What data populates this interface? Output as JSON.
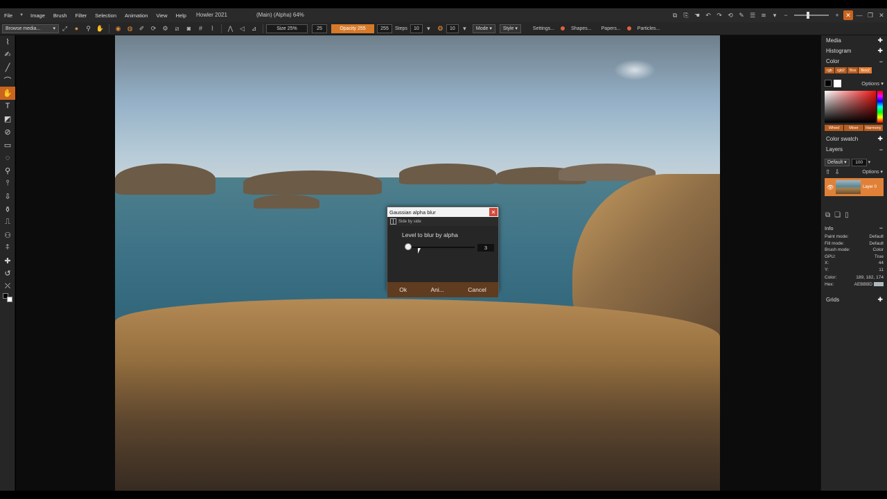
{
  "menu": {
    "items": [
      "File",
      "Image",
      "Brush",
      "Filter",
      "Selection",
      "Animation",
      "View",
      "Help"
    ],
    "app_title": "Howler 2021",
    "doc_title": "(Main) (Alpha)  64%"
  },
  "toolbar": {
    "browse_label": "Browse media...",
    "size_label": "Size 25%",
    "size_value": "25",
    "opacity_label": "Opacity 255",
    "opacity_value": "255",
    "steps_label": "Steps",
    "steps_value": "10",
    "spacing_value": "10",
    "mode_label": "Mode",
    "style_label": "Style",
    "settings_label": "Settings...",
    "shapes_label": "Shapes...",
    "papers_label": "Papers...",
    "particles_label": "Particles..."
  },
  "dialog": {
    "title": "Gaussian alpha blur",
    "side_by_side": "Side by side",
    "level_label": "Level to blur by alpha",
    "level_value": "3",
    "level_fraction": 0.0,
    "ok_label": "Ok",
    "ani_label": "Ani...",
    "cancel_label": "Cancel"
  },
  "right_panel": {
    "media": "Media",
    "histogram": "Histogram",
    "color": "Color",
    "color_tabs": [
      "rgb",
      "rgb2",
      "Box",
      "Box2"
    ],
    "options_label": "Options",
    "picker_tabs": [
      "Wheel",
      "Mixer",
      "Harmony"
    ],
    "color_swatch": "Color swatch",
    "layers": "Layers",
    "layer_mode": "Default",
    "layer_opacity": "100",
    "layer_options": "Options",
    "layer_name": "Layer 0",
    "info": "Info",
    "info_rows": [
      {
        "k": "Paint mode:",
        "v": "Default"
      },
      {
        "k": "Fill mode:",
        "v": "Default"
      },
      {
        "k": "Brush mode:",
        "v": "Color"
      },
      {
        "k": "GPU:",
        "v": "True"
      },
      {
        "k": "X:",
        "v": "44"
      },
      {
        "k": "Y:",
        "v": "11"
      }
    ],
    "color_readout_label": "Color:",
    "color_readout": "189, 182, 174",
    "hex_label": "Hex:",
    "hex_value": "AEBBBD",
    "grids": "Grids"
  },
  "colors": {
    "accent": "#c8641e",
    "dialog_footer": "#5f3b1f",
    "hex_swatch": "#aebbbd"
  }
}
